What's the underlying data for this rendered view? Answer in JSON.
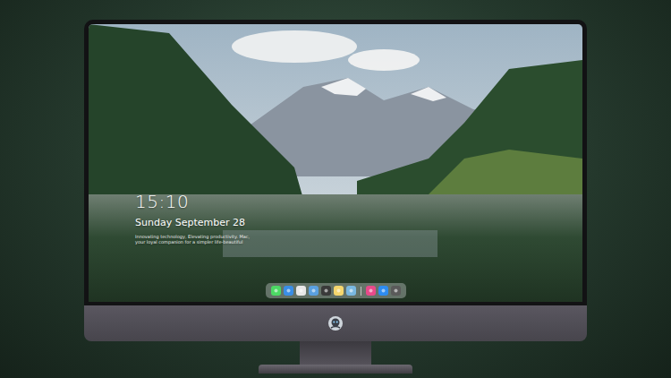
{
  "lock_screen": {
    "time": "15:10",
    "date": "Sunday September 28",
    "tagline": [
      "Innovating technology, Elevating productivity. Mac,",
      "your loyal companion for a simpler life-beautiful"
    ]
  },
  "dock": {
    "apps": [
      {
        "color": "#4cd964"
      },
      {
        "color": "#3a8ee6"
      },
      {
        "color": "#e8e8e8"
      },
      {
        "color": "#5aa0e0"
      },
      {
        "color": "#3a3a3a"
      },
      {
        "color": "#f5d76e"
      },
      {
        "color": "#7ab8e0"
      },
      {
        "color": "#e84a8a"
      },
      {
        "color": "#2d8cf0"
      },
      {
        "color": "#5a5a5a"
      }
    ]
  }
}
